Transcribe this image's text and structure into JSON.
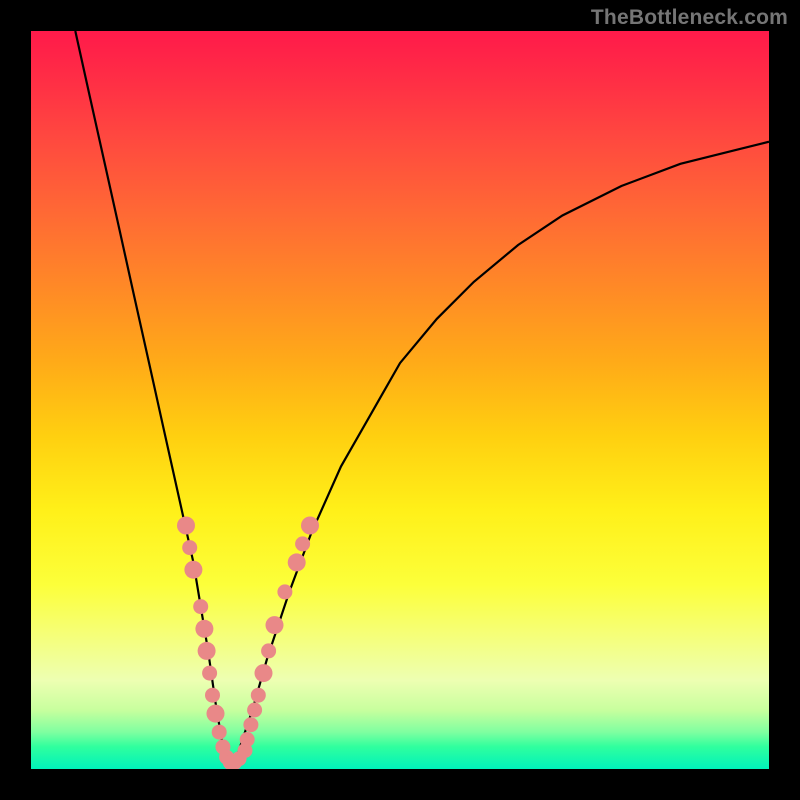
{
  "watermark": "TheBottleneck.com",
  "colors": {
    "page_bg": "#000000",
    "curve": "#000000",
    "dots": "#e98888",
    "gradient_top": "#ff1a4a",
    "gradient_bottom": "#00f2bb"
  },
  "chart_data": {
    "type": "line",
    "title": "",
    "xlabel": "",
    "ylabel": "",
    "xlim": [
      0,
      100
    ],
    "ylim": [
      0,
      100
    ],
    "note": "No tick labels are rendered; x/y values are estimated percentages of the plot area (0=left/bottom, 100=right/top). The curve has a sharp minimum near x≈27, y≈0.",
    "series": [
      {
        "name": "bottleneck-curve",
        "x": [
          6,
          8,
          10,
          12,
          14,
          16,
          18,
          20,
          22,
          24,
          25,
          26,
          27,
          28,
          30,
          32,
          35,
          38,
          42,
          46,
          50,
          55,
          60,
          66,
          72,
          80,
          88,
          96,
          100
        ],
        "y": [
          100,
          91,
          82,
          73,
          64,
          55,
          46,
          37,
          28,
          16,
          9,
          3,
          0,
          2,
          8,
          15,
          24,
          32,
          41,
          48,
          55,
          61,
          66,
          71,
          75,
          79,
          82,
          84,
          85
        ]
      }
    ],
    "scatter_overlay": {
      "name": "highlighted-points",
      "color": "#e98888",
      "note": "Clustered dots visible along the lower part of the curve; values estimated.",
      "points": [
        {
          "x": 21,
          "y": 33,
          "r": 1.2
        },
        {
          "x": 21.5,
          "y": 30,
          "r": 1.0
        },
        {
          "x": 22,
          "y": 27,
          "r": 1.2
        },
        {
          "x": 23,
          "y": 22,
          "r": 1.0
        },
        {
          "x": 23.5,
          "y": 19,
          "r": 1.2
        },
        {
          "x": 23.8,
          "y": 16,
          "r": 1.2
        },
        {
          "x": 24.2,
          "y": 13,
          "r": 1.0
        },
        {
          "x": 24.6,
          "y": 10,
          "r": 1.0
        },
        {
          "x": 25.0,
          "y": 7.5,
          "r": 1.2
        },
        {
          "x": 25.5,
          "y": 5,
          "r": 1.0
        },
        {
          "x": 26,
          "y": 3,
          "r": 1.0
        },
        {
          "x": 26.5,
          "y": 1.6,
          "r": 1.0
        },
        {
          "x": 27,
          "y": 0.9,
          "r": 1.0
        },
        {
          "x": 27.6,
          "y": 0.9,
          "r": 1.0
        },
        {
          "x": 28.2,
          "y": 1.4,
          "r": 1.0
        },
        {
          "x": 29,
          "y": 2.5,
          "r": 1.0
        },
        {
          "x": 29.3,
          "y": 4,
          "r": 1.0
        },
        {
          "x": 29.8,
          "y": 6,
          "r": 1.0
        },
        {
          "x": 30.3,
          "y": 8,
          "r": 1.0
        },
        {
          "x": 30.8,
          "y": 10,
          "r": 1.0
        },
        {
          "x": 31.5,
          "y": 13,
          "r": 1.2
        },
        {
          "x": 32.2,
          "y": 16,
          "r": 1.0
        },
        {
          "x": 33,
          "y": 19.5,
          "r": 1.2
        },
        {
          "x": 34.4,
          "y": 24,
          "r": 1.0
        },
        {
          "x": 36,
          "y": 28,
          "r": 1.2
        },
        {
          "x": 36.8,
          "y": 30.5,
          "r": 1.0
        },
        {
          "x": 37.8,
          "y": 33,
          "r": 1.2
        }
      ]
    }
  }
}
